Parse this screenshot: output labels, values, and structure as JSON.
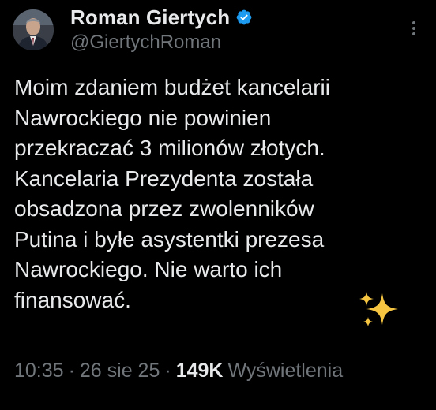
{
  "author": {
    "display_name": "Roman Giertych",
    "handle": "@GiertychRoman",
    "verified": true,
    "verified_icon": "verified-badge-icon",
    "avatar_icon": "avatar"
  },
  "more_icon": "more-vertical-icon",
  "tweet": {
    "lines": [
      "Moim zdaniem budżet kancelarii",
      "Nawrockiego nie powinien",
      "przekraczać 3 milionów złotych.",
      "Kancelaria Prezydenta została",
      "obsadzona przez zwolenników",
      "Putina i byłe asystentki prezesa",
      "Nawrockiego. Nie warto ich",
      "finansować."
    ],
    "emoji": "sparkles-icon"
  },
  "meta": {
    "time": "10:35",
    "separator": "·",
    "date": "26 sie 25",
    "views_count": "149K",
    "views_label": "Wyświetlenia"
  },
  "colors": {
    "background": "#000000",
    "text_primary": "#e7e9ea",
    "text_secondary": "#71767b",
    "verified_blue": "#1d9bf0",
    "sparkle_gold": "#f5c542"
  }
}
